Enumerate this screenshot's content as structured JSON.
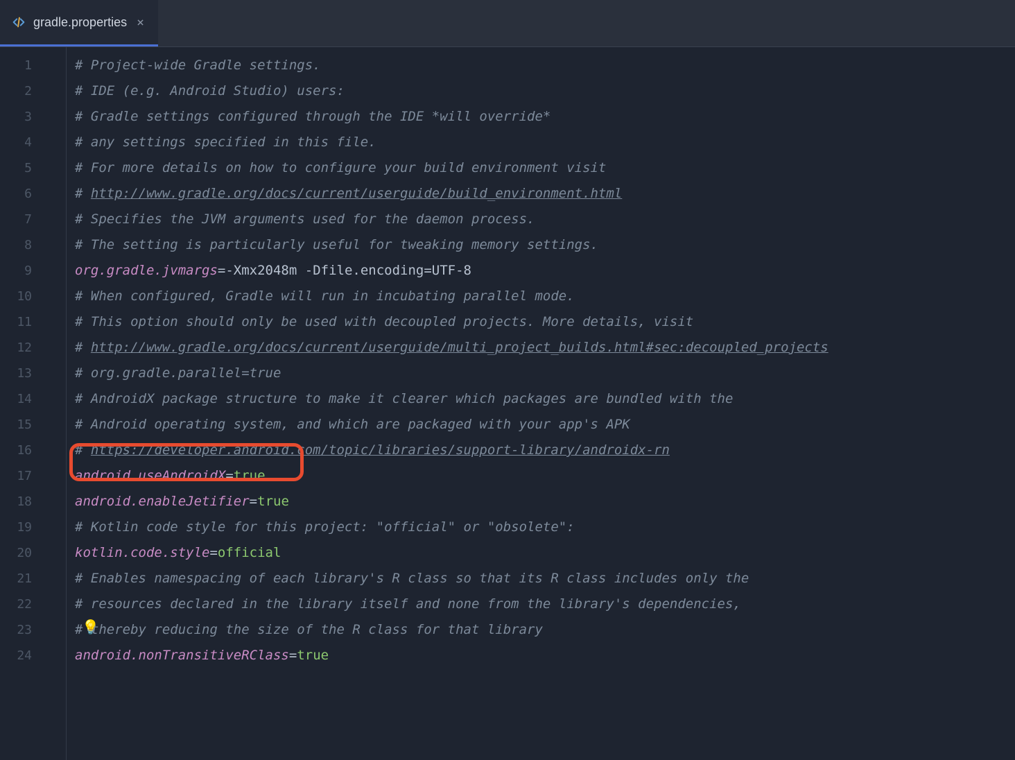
{
  "tab": {
    "name": "gradle.properties",
    "icon": "code-icon"
  },
  "lines": [
    {
      "n": 1,
      "type": "comment",
      "parts": [
        {
          "t": "# Project-wide Gradle settings.",
          "c": "comment"
        }
      ]
    },
    {
      "n": 2,
      "type": "comment",
      "parts": [
        {
          "t": "# IDE (e.g. Android Studio) users:",
          "c": "comment"
        }
      ]
    },
    {
      "n": 3,
      "type": "comment",
      "parts": [
        {
          "t": "# Gradle settings configured through the IDE *will override*",
          "c": "comment"
        }
      ]
    },
    {
      "n": 4,
      "type": "comment",
      "parts": [
        {
          "t": "# any settings specified in this file.",
          "c": "comment"
        }
      ]
    },
    {
      "n": 5,
      "type": "comment",
      "parts": [
        {
          "t": "# For more details on how to configure your build environment visit",
          "c": "comment"
        }
      ]
    },
    {
      "n": 6,
      "type": "comment",
      "parts": [
        {
          "t": "# ",
          "c": "comment"
        },
        {
          "t": "http://www.gradle.org/docs/current/userguide/build_environment.html",
          "c": "link-comment"
        }
      ]
    },
    {
      "n": 7,
      "type": "comment",
      "parts": [
        {
          "t": "# Specifies the JVM arguments used for the daemon process.",
          "c": "comment"
        }
      ]
    },
    {
      "n": 8,
      "type": "comment",
      "parts": [
        {
          "t": "# The setting is particularly useful for tweaking memory settings.",
          "c": "comment"
        }
      ]
    },
    {
      "n": 9,
      "type": "prop",
      "parts": [
        {
          "t": "org.gradle.jvmargs",
          "c": "prop-key"
        },
        {
          "t": "=",
          "c": "eq"
        },
        {
          "t": "-Xmx2048m -Dfile.encoding=UTF-8",
          "c": "flag"
        }
      ]
    },
    {
      "n": 10,
      "type": "comment",
      "parts": [
        {
          "t": "# When configured, Gradle will run in incubating parallel mode.",
          "c": "comment"
        }
      ]
    },
    {
      "n": 11,
      "type": "comment",
      "parts": [
        {
          "t": "# This option should only be used with decoupled projects. More details, visit",
          "c": "comment"
        }
      ]
    },
    {
      "n": 12,
      "type": "comment",
      "parts": [
        {
          "t": "# ",
          "c": "comment"
        },
        {
          "t": "http://www.gradle.org/docs/current/userguide/multi_project_builds.html#sec:decoupled_projects",
          "c": "link-comment"
        }
      ]
    },
    {
      "n": 13,
      "type": "comment",
      "parts": [
        {
          "t": "# org.gradle.parallel=true",
          "c": "comment"
        }
      ]
    },
    {
      "n": 14,
      "type": "comment",
      "parts": [
        {
          "t": "# AndroidX package structure to make it clearer which packages are bundled with the",
          "c": "comment"
        }
      ]
    },
    {
      "n": 15,
      "type": "comment",
      "parts": [
        {
          "t": "# Android operating system, and which are packaged with your app's APK",
          "c": "comment"
        }
      ]
    },
    {
      "n": 16,
      "type": "comment",
      "parts": [
        {
          "t": "# ",
          "c": "comment"
        },
        {
          "t": "https://developer.android.com/topic/libraries/support-library/androidx-rn",
          "c": "link-comment"
        }
      ]
    },
    {
      "n": 17,
      "type": "prop",
      "parts": [
        {
          "t": "android.useAndroidX",
          "c": "prop-key"
        },
        {
          "t": "=",
          "c": "eq"
        },
        {
          "t": "true",
          "c": "val"
        }
      ]
    },
    {
      "n": 18,
      "type": "prop",
      "parts": [
        {
          "t": "android.enableJetifier",
          "c": "prop-key"
        },
        {
          "t": "=",
          "c": "eq"
        },
        {
          "t": "true",
          "c": "val"
        }
      ]
    },
    {
      "n": 19,
      "type": "comment",
      "parts": [
        {
          "t": "# Kotlin code style for this project: \"official\" or \"obsolete\":",
          "c": "comment"
        }
      ]
    },
    {
      "n": 20,
      "type": "prop",
      "parts": [
        {
          "t": "kotlin.code.style",
          "c": "prop-key"
        },
        {
          "t": "=",
          "c": "eq"
        },
        {
          "t": "official",
          "c": "val"
        }
      ]
    },
    {
      "n": 21,
      "type": "comment",
      "parts": [
        {
          "t": "# Enables namespacing of each library's R class so that its R class includes only the",
          "c": "comment"
        }
      ]
    },
    {
      "n": 22,
      "type": "comment",
      "parts": [
        {
          "t": "# resources declared in the library itself and none from the library's dependencies,",
          "c": "comment"
        }
      ]
    },
    {
      "n": 23,
      "type": "comment",
      "parts": [
        {
          "t": "# thereby reducing the size of the R class for that library",
          "c": "comment"
        }
      ]
    },
    {
      "n": 24,
      "type": "prop",
      "parts": [
        {
          "t": "android.nonTransitiveRClass",
          "c": "prop-key"
        },
        {
          "t": "=",
          "c": "eq"
        },
        {
          "t": "true",
          "c": "val"
        }
      ]
    }
  ],
  "annotations": {
    "highlighted_line": 18,
    "intention_bulb_line": 23
  }
}
